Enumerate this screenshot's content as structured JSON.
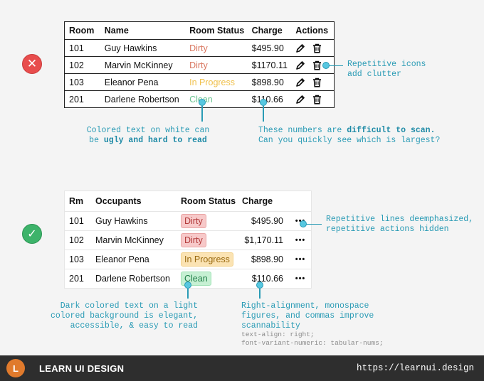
{
  "bad_table": {
    "headers": [
      "Room",
      "Name",
      "Room Status",
      "Charge",
      "Actions"
    ],
    "rows": [
      {
        "room": "101",
        "name": "Guy Hawkins",
        "status": "Dirty",
        "status_color": "#d9765f",
        "charge": "$495.90"
      },
      {
        "room": "102",
        "name": "Marvin McKinney",
        "status": "Dirty",
        "status_color": "#d9765f",
        "charge": "$1170.11"
      },
      {
        "room": "103",
        "name": "Eleanor Pena",
        "status": "In Progress",
        "status_color": "#f0c14d",
        "charge": "$898.90"
      },
      {
        "room": "201",
        "name": "Darlene Robertson",
        "status": "Clean",
        "status_color": "#6cc592",
        "charge": "$110.66"
      }
    ],
    "action_icons": [
      "pencil-icon",
      "trash-icon"
    ]
  },
  "good_table": {
    "headers": [
      "Rm",
      "Occupants",
      "Room Status",
      "Charge",
      ""
    ],
    "rows": [
      {
        "room": "101",
        "name": "Guy Hawkins",
        "status": "Dirty",
        "status_text": "#b23a3a",
        "status_bg": "#f7c9c9",
        "status_border": "#eaa5a5",
        "charge": "$495.90"
      },
      {
        "room": "102",
        "name": "Marvin McKinney",
        "status": "Dirty",
        "status_text": "#b23a3a",
        "status_bg": "#f7c9c9",
        "status_border": "#eaa5a5",
        "charge": "$1,170.11"
      },
      {
        "room": "103",
        "name": "Eleanor Pena",
        "status": "In Progress",
        "status_text": "#9a6a10",
        "status_bg": "#fbe3b3",
        "status_border": "#f3d28d",
        "charge": "$898.90"
      },
      {
        "room": "201",
        "name": "Darlene Robertson",
        "status": "Clean",
        "status_text": "#23804a",
        "status_bg": "#c6f0d3",
        "status_border": "#9fe2b5",
        "charge": "$110.66"
      }
    ],
    "more_label": "•••"
  },
  "annotations": {
    "colored_text_1": "Colored text on white can",
    "colored_text_2_prefix": "be ",
    "colored_text_2_bold": "ugly and hard to read",
    "numbers_1_prefix": "These numbers are ",
    "numbers_1_bold": "difficult to scan.",
    "numbers_2": "Can you quickly see which is largest?",
    "icons_1": "Repetitive icons",
    "icons_2": "add clutter",
    "lines_1": "Repetitive lines deemphasized,",
    "lines_2": "repetitive actions hidden",
    "dark_1": "Dark colored text on a light",
    "dark_2": "colored background is elegant,",
    "dark_3": "accessible, & easy to read",
    "align_1": "Right-alignment, monospace",
    "align_2": "figures, and commas improve",
    "align_3": "scannability",
    "code_1": "text-align: right;",
    "code_2": "font-variant-numeric: tabular-nums;"
  },
  "markers": {
    "bad": "✕",
    "good": "✓"
  },
  "footer": {
    "logo_letter": "L",
    "brand": "LEARN UI DESIGN",
    "url": "https://learnui.design"
  }
}
